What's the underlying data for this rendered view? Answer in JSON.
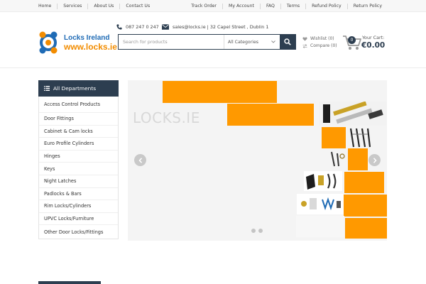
{
  "top_nav_left": [
    "Home",
    "Services",
    "About Us",
    "Contact Us"
  ],
  "top_nav_right": [
    "Track Order",
    "My Account",
    "FAQ",
    "Terms",
    "Refund Policy",
    "Return Policy"
  ],
  "logo": {
    "line1": "Locks Ireland",
    "line2": "www.locks.ie"
  },
  "contact": {
    "phone": "087 247 0 247",
    "email": "sales@locks.ie | 32 Capel Street , Dublin 1"
  },
  "search": {
    "placeholder": "Search for products",
    "category": "All Categories"
  },
  "wishlist": "Wishlist (0)",
  "compare": "Compare (0)",
  "cart": {
    "label": "Your Cart:",
    "count": "0",
    "total": "€0.00"
  },
  "departments": {
    "title": "All Departments",
    "items": [
      "Access Control Products",
      "Door Fittings",
      "Cabinet & Cam locks",
      "Euro Profile Cylinders",
      "Hinges",
      "Keys",
      "Night Latches",
      "Padlocks & Bars",
      "Rim Locks/Cylinders",
      "UPVC Locks/Furniture",
      "Other Door Locks/Fittings"
    ]
  },
  "slider": {
    "brand": "LOCKS.IE",
    "slide_count": 2,
    "active_slide": 1
  },
  "colors": {
    "navy": "#2d3e50",
    "orange": "#ff9900",
    "logo_blue": "#1f6bb5",
    "logo_orange": "#f28c00"
  },
  "icons": [
    "phone-icon",
    "envelope-icon",
    "search-icon",
    "chevron-down-icon",
    "heart-icon",
    "compare-icon",
    "cart-icon",
    "menu-icon",
    "chevron-left-icon",
    "chevron-right-icon"
  ]
}
